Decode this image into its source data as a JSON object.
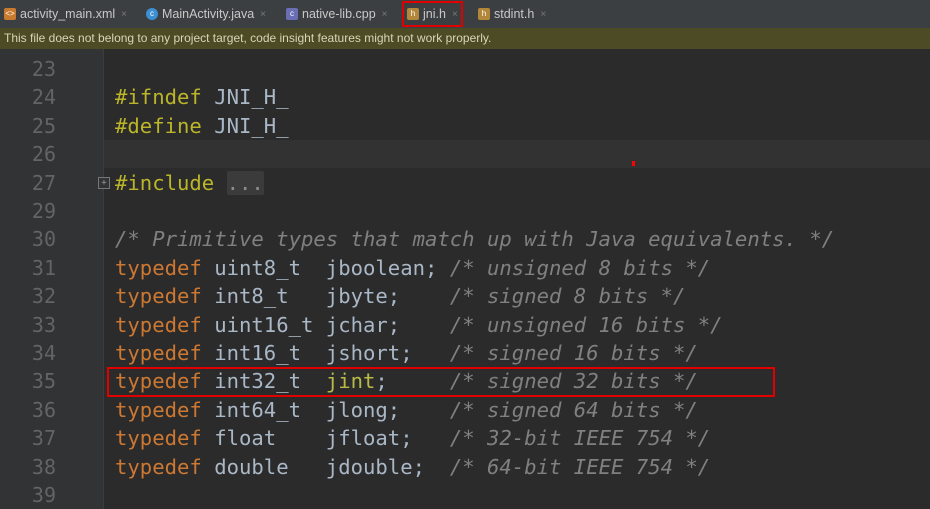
{
  "tabs": [
    {
      "label": "activity_main.xml",
      "icon": "xml-file-icon"
    },
    {
      "label": "MainActivity.java",
      "icon": "java-class-icon"
    },
    {
      "label": "native-lib.cpp",
      "icon": "cpp-file-icon"
    },
    {
      "label": "jni.h",
      "icon": "header-file-icon",
      "active": true
    },
    {
      "label": "stdint.h",
      "icon": "header-file-icon"
    }
  ],
  "close_glyph": "×",
  "banner": "This file does not belong to any project target, code insight features might not work properly.",
  "editor": {
    "lines": [
      {
        "n": "23"
      },
      {
        "n": "24",
        "pp": "#ifndef",
        "rest": " JNI_H_"
      },
      {
        "n": "25",
        "pp": "#define",
        "rest": " JNI_H_"
      },
      {
        "n": "26"
      },
      {
        "n": "27",
        "pp": "#include",
        "rest": " ",
        "fold": "..."
      },
      {
        "n": "29"
      },
      {
        "n": "30",
        "comment": "/* Primitive types that match up with Java equivalents. */"
      },
      {
        "n": "31",
        "kw": "typedef",
        "type": " uint8_t  ",
        "name": "jboolean",
        "semi": ";",
        "pad": " ",
        "comment": "/* unsigned 8 bits */"
      },
      {
        "n": "32",
        "kw": "typedef",
        "type": " int8_t   ",
        "name": "jbyte",
        "semi": ";",
        "pad": "    ",
        "comment": "/* signed 8 bits */"
      },
      {
        "n": "33",
        "kw": "typedef",
        "type": " uint16_t ",
        "name": "jchar",
        "semi": ";",
        "pad": "    ",
        "comment": "/* unsigned 16 bits */"
      },
      {
        "n": "34",
        "kw": "typedef",
        "type": " int16_t  ",
        "name": "jshort",
        "semi": ";",
        "pad": "   ",
        "comment": "/* signed 16 bits */"
      },
      {
        "n": "35",
        "kw": "typedef",
        "type": " int32_t  ",
        "name": "jint",
        "semi": ";",
        "pad": "     ",
        "comment": "/* signed 32 bits */"
      },
      {
        "n": "36",
        "kw": "typedef",
        "type": " int64_t  ",
        "name": "jlong",
        "semi": ";",
        "pad": "    ",
        "comment": "/* signed 64 bits */"
      },
      {
        "n": "37",
        "kw": "typedef",
        "type": " float    ",
        "name": "jfloat",
        "semi": ";",
        "pad": "   ",
        "comment": "/* 32-bit IEEE 754 */"
      },
      {
        "n": "38",
        "kw": "typedef",
        "type": " double   ",
        "name": "jdouble",
        "semi": ";",
        "pad": "  ",
        "comment": "/* 64-bit IEEE 754 */"
      },
      {
        "n": "39"
      }
    ]
  },
  "colors": {
    "editor_bg": "#2b2b2b",
    "keyword": "#cc7832",
    "preprocessor": "#bbb529",
    "comment": "#808080",
    "warning_banner": "#4d4b25",
    "highlight_border": "#e00000"
  }
}
